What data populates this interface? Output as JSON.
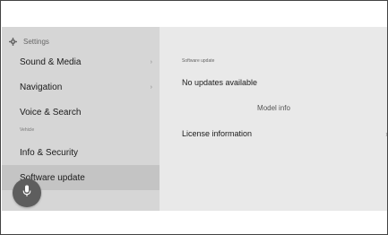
{
  "sidebar": {
    "header": "Settings",
    "items": [
      {
        "label": "Sound & Media",
        "chevron": "›"
      },
      {
        "label": "Navigation",
        "chevron": "›"
      },
      {
        "label": "Voice & Search",
        "chevron": ""
      }
    ],
    "section_label": "Vehicle",
    "vehicle_items": [
      {
        "label": "Info & Security"
      },
      {
        "label": "Software update",
        "selected": true
      }
    ]
  },
  "main": {
    "section_label": "Software update",
    "status": "No updates available",
    "model_info": "Model info",
    "license": {
      "label": "License information",
      "chevron": "›"
    }
  },
  "icons": {
    "settings": "gear-icon",
    "voice": "microphone-icon"
  },
  "colors": {
    "sidebar_bg": "#d6d6d6",
    "content_bg": "#e9e9e9",
    "selected_bg": "#c4c4c4",
    "mic_button": "#5e5e5e"
  }
}
